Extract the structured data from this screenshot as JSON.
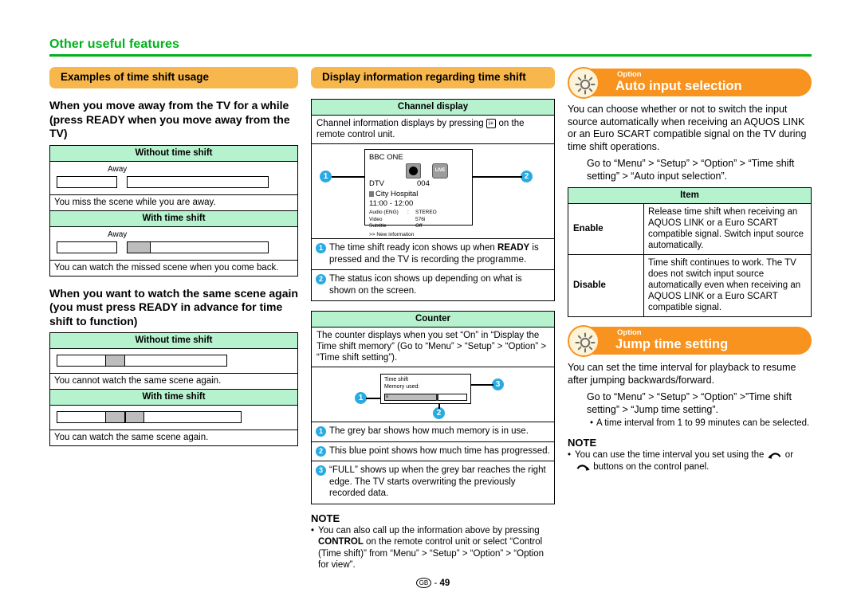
{
  "chapter": {
    "title": "Other useful features"
  },
  "left": {
    "section_bar": "Examples of time shift usage",
    "heading1": "When you move away from the TV for a while (press READY when you move away from the TV)",
    "table1": {
      "without_label": "Without time shift",
      "without_away": "Away",
      "without_caption": "You miss the scene while you are away.",
      "with_label": "With time shift",
      "with_away": "Away",
      "with_caption": "You can watch the missed scene when you come back."
    },
    "heading2": "When you want to watch the same scene again (you must press READY in advance for time shift to function)",
    "table2": {
      "without_label": "Without time shift",
      "without_caption": "You cannot watch the same scene again.",
      "with_label": "With time shift",
      "with_caption": "You can watch the same scene again."
    }
  },
  "middle": {
    "section_bar": "Display information regarding time shift",
    "channel_display": {
      "header": "Channel display",
      "intro_a": "Channel information displays by pressing",
      "intro_icon": "i+",
      "intro_b": "on the remote control unit.",
      "tv": {
        "channel_name": "BBC ONE",
        "source": "DTV",
        "number": "004",
        "programme": "City Hospital",
        "time": "11:00 - 12:00",
        "audio_label": "Audio (ENG)",
        "audio_colon": ":",
        "audio_value": "STEREO",
        "video_label": "Video",
        "video_value": "576i",
        "subtitle_label": "Subtitle",
        "subtitle_value": "Off",
        "new_info": ">> New information",
        "live_badge": "LIVE"
      },
      "callout1": "1",
      "callout2": "2",
      "notes": [
        {
          "n": "1",
          "text_a": "The time shift ready icon shows up when ",
          "bold": "READY",
          "text_b": " is pressed and the TV is recording the programme."
        },
        {
          "n": "2",
          "text_a": "The status icon shows up depending on what is shown on the screen.",
          "bold": "",
          "text_b": ""
        }
      ]
    },
    "counter": {
      "header": "Counter",
      "intro": "The counter displays when you set “On” in “Display the Time shift memory” (Go to “Menu” > “Setup” > “Option” > “Time shift setting”).",
      "osd": {
        "line1": "Time shift",
        "line2": "Memory used:"
      },
      "callout1": "1",
      "callout2": "2",
      "callout3": "3",
      "notes": [
        {
          "n": "1",
          "text": "The grey bar shows how much memory is in use."
        },
        {
          "n": "2",
          "text": "This blue point shows how much time has progressed."
        },
        {
          "n": "3",
          "text": "“FULL” shows up when the grey bar reaches the right edge. The TV starts overwriting the previously recorded data."
        }
      ]
    },
    "note": {
      "title": "NOTE",
      "bullet": "•",
      "text_a": "You can also call up the information above by pressing ",
      "bold": "CONTROL",
      "text_b": " on the remote control unit or select “Control (Time shift)” from “Menu” > “Setup” > “Option” > “Option for view”."
    },
    "footer": {
      "region": "GB",
      "dash": "-",
      "page": "49"
    }
  },
  "right": {
    "option1": {
      "kicker": "Option",
      "title": "Auto input selection",
      "body": "You can choose whether or not to switch the input source automatically when receiving an AQUOS LINK or an Euro SCART compatible signal on the TV during time shift operations.",
      "path": "Go to “Menu” > “Setup” > “Option” > “Time shift setting” > “Auto input selection”.",
      "table": {
        "header": "Item",
        "rows": [
          {
            "key": "Enable",
            "value": "Release time shift when receiving an AQUOS LINK or a Euro SCART compatible signal. Switch input source automatically."
          },
          {
            "key": "Disable",
            "value": "Time shift continues to work. The TV does not switch input source automatically even when receiving an AQUOS LINK or a Euro SCART compatible signal."
          }
        ]
      }
    },
    "option2": {
      "kicker": "Option",
      "title": "Jump time setting",
      "body": "You can set the time interval for playback to resume after jumping backwards/forward.",
      "path": "Go to “Menu” > “Setup” > “Option” >”Time shift setting” > “Jump time setting”.",
      "bullet_mark": "•",
      "bullet": "A time interval from 1 to 99 minutes can be selected.",
      "note": {
        "title": "NOTE",
        "bullet": "•",
        "text_a": "You can use the time interval you set using the",
        "text_mid": "or",
        "text_b": "buttons on the control panel."
      }
    }
  },
  "colors": {
    "green": "#00b11b",
    "orange_bar": "#f8b74c",
    "orange_option": "#f7931e",
    "table_green": "#b6f2cd",
    "callout_blue": "#29abe2"
  }
}
